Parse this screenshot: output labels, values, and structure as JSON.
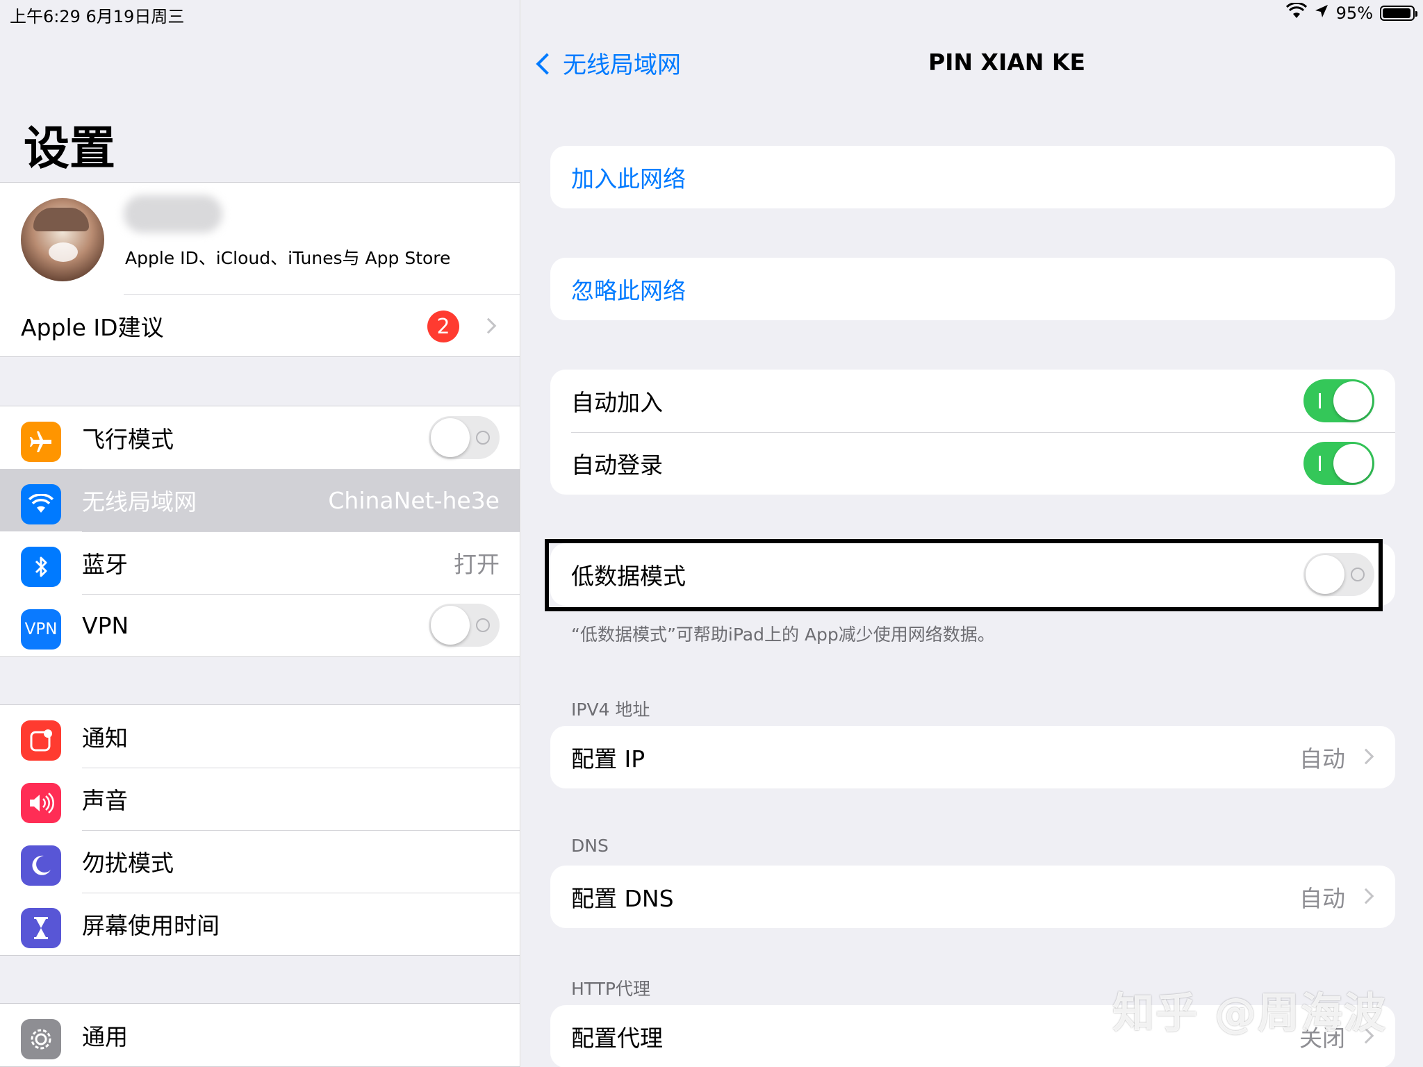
{
  "status_bar": {
    "time_date": "上午6:29   6月19日周三",
    "battery": "95%",
    "battery_level": 0.95,
    "icons": [
      "wifi-icon",
      "location-icon",
      "battery-icon"
    ]
  },
  "left": {
    "title": "设置",
    "profile": {
      "subtitle": "Apple ID、iCloud、iTunes与 App Store"
    },
    "apple_id_suggestions": {
      "label": "Apple ID建议",
      "badge": "2"
    },
    "network_items": [
      {
        "label": "飞行模式",
        "icon": "airplane-icon",
        "color": "#ff9500",
        "toggle": false
      },
      {
        "label": "无线局域网",
        "icon": "wifi-icon",
        "color": "#007aff",
        "value": "ChinaNet-he3e",
        "selected": true
      },
      {
        "label": "蓝牙",
        "icon": "bluetooth-icon",
        "color": "#007aff",
        "value": "打开"
      },
      {
        "label": "VPN",
        "icon": "vpn-icon",
        "icon_text": "VPN",
        "color": "#0a7aff",
        "toggle": false
      }
    ],
    "notif_items": [
      {
        "label": "通知",
        "icon": "notifications-icon",
        "color": "#ff3b30"
      },
      {
        "label": "声音",
        "icon": "sound-icon",
        "color": "#ff2d55"
      },
      {
        "label": "勿扰模式",
        "icon": "moon-icon",
        "color": "#5856d6"
      },
      {
        "label": "屏幕使用时间",
        "icon": "hourglass-icon",
        "color": "#5856d6"
      }
    ],
    "general_items": [
      {
        "label": "通用",
        "icon": "gear-icon",
        "color": "#8e8e93"
      }
    ]
  },
  "right": {
    "back_label": "无线局域网",
    "title": "PIN XIAN KE",
    "join": "加入此网络",
    "forget": "忽略此网络",
    "auto_join": {
      "label": "自动加入",
      "on": true
    },
    "auto_login": {
      "label": "自动登录",
      "on": true
    },
    "low_data": {
      "label": "低数据模式",
      "on": false,
      "footer": "“低数据模式”可帮助iPad上的 App减少使用网络数据。"
    },
    "ipv4": {
      "header": "IPV4 地址",
      "label": "配置 IP",
      "value": "自动"
    },
    "dns": {
      "header": "DNS",
      "label": "配置 DNS",
      "value": "自动"
    },
    "http": {
      "header": "HTTP代理",
      "label": "配置代理",
      "value": "关闭"
    }
  },
  "watermark": "知乎 @周海波",
  "colors": {
    "accent": "#007aff",
    "toggle_on": "#34c759",
    "badge": "#ff3b30",
    "background": "#efeff4"
  }
}
